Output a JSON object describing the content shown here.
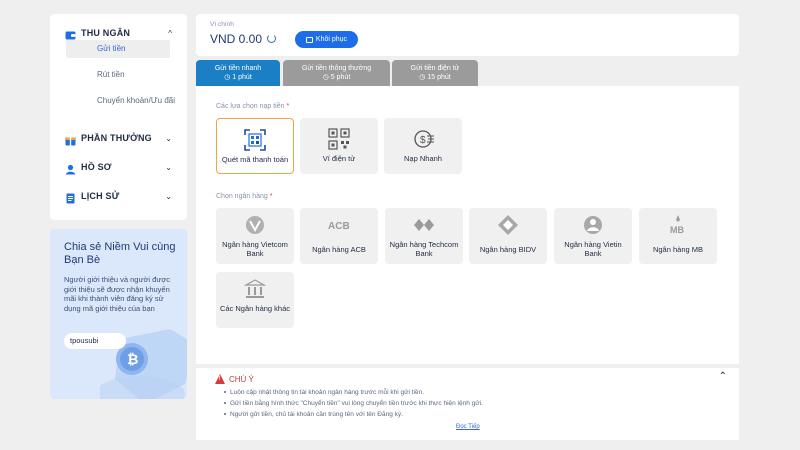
{
  "sidebar": {
    "menus": [
      {
        "label": "THU NGÂN",
        "icon": "wallet-icon",
        "chevron": "^"
      },
      {
        "label": "PHẦN THƯỞNG",
        "icon": "gift-icon",
        "chevron": "⌄"
      },
      {
        "label": "HỒ SƠ",
        "icon": "user-icon",
        "chevron": "⌄"
      },
      {
        "label": "LỊCH SỬ",
        "icon": "history-icon",
        "chevron": "⌄"
      }
    ],
    "submenu": [
      "Gửi tiền",
      "Rút tiền",
      "Chuyển khoản/Ưu đãi"
    ]
  },
  "referral": {
    "title": "Chia sẻ Niềm Vui cùng Bạn Bè",
    "description": "Người giới thiệu và người được giới thiệu sẽ được nhận khuyến mãi khi thành viên đăng ký sử dụng mã giới thiệu của bạn",
    "code": "tpousubi"
  },
  "wallet": {
    "label": "Ví chính",
    "value": "VND 0.00",
    "restore_label": "Khôi phục"
  },
  "tabs": [
    {
      "label": "Gửi tiền nhanh",
      "time": "1 phút",
      "active": true
    },
    {
      "label": "Gửi tiền thông thường",
      "time": "5 phút",
      "active": false
    },
    {
      "label": "Gửi tiền điện tử",
      "time": "15 phút",
      "active": false
    }
  ],
  "deposit_options": {
    "label": "Các lựa chọn nạp tiền",
    "required_mark": "*",
    "items": [
      {
        "label": "Quét mã thanh toán",
        "icon": "qr-scan-icon",
        "selected": true
      },
      {
        "label": "Ví điện tử",
        "icon": "qr-code-icon",
        "selected": false
      },
      {
        "label": "Nạp Nhanh",
        "icon": "fast-deposit-icon",
        "selected": false
      }
    ]
  },
  "banks": {
    "label": "Chọn ngân hàng",
    "required_mark": "*",
    "items": [
      {
        "label": "Ngân hàng Vietcom Bank",
        "icon": "vietcombank-icon"
      },
      {
        "label": "Ngân hàng ACB",
        "icon": "acb-icon",
        "logo_text": "ACB"
      },
      {
        "label": "Ngân hàng Techcom Bank",
        "icon": "techcombank-icon"
      },
      {
        "label": "Ngân hàng BIDV",
        "icon": "bidv-icon"
      },
      {
        "label": "Ngân hàng Vietin Bank",
        "icon": "vietinbank-icon"
      },
      {
        "label": "Ngân hàng MB",
        "icon": "mb-icon",
        "logo_text": "MB"
      },
      {
        "label": "Các Ngân hàng khác",
        "icon": "bank-building-icon"
      }
    ]
  },
  "notice": {
    "title": "CHÚ Ý",
    "items": [
      "Luôn cập nhật thông tin tài khoản ngân hàng trước mỗi khi gửi tiền.",
      "Gửi tiền bằng hình thức \"Chuyển tiền\" vui lòng chuyển tiền trước khi thực hiện lệnh gửi.",
      "Người gửi tiền, chủ tài khoản cần trùng tên với tên Đăng ký."
    ],
    "more_label": "Đọc Tiếp"
  },
  "colors": {
    "primary": "#1e6de8",
    "tab_active": "#1a7fc4",
    "tab_inactive": "#9b9b9b",
    "selected_border": "#f0a640",
    "warning": "#d63a3a"
  }
}
